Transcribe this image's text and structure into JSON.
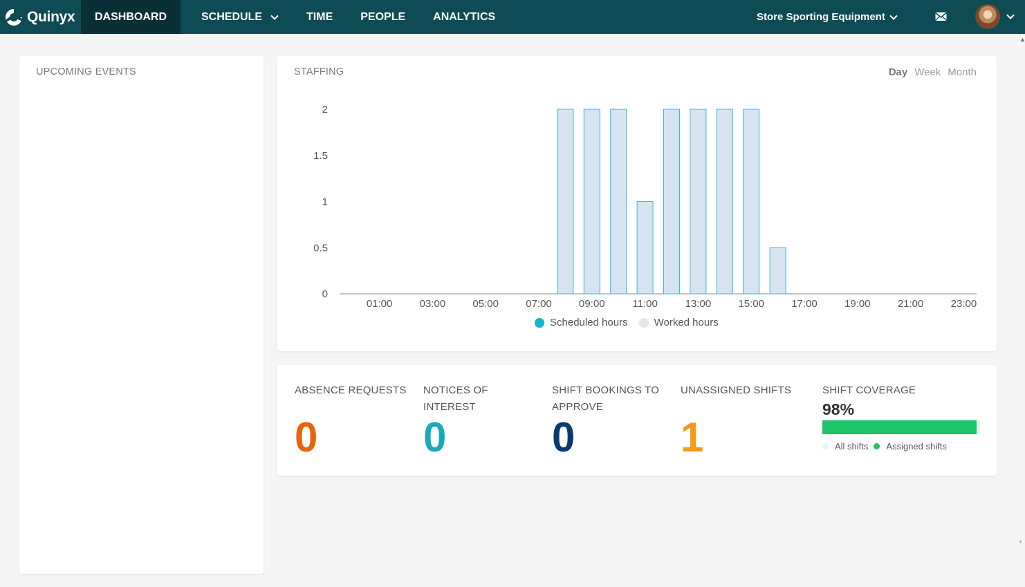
{
  "app": {
    "logo_text": "Quinyx"
  },
  "nav": {
    "items": [
      {
        "label": "DASHBOARD"
      },
      {
        "label": "SCHEDULE"
      },
      {
        "label": "TIME"
      },
      {
        "label": "PEOPLE"
      },
      {
        "label": "ANALYTICS"
      }
    ],
    "active": "DASHBOARD",
    "store": "Store Sporting Equipment"
  },
  "events": {
    "title": "UPCOMING EVENTS"
  },
  "staffing": {
    "title": "STAFFING",
    "periods": [
      "Day",
      "Week",
      "Month"
    ],
    "selected_period": "Day"
  },
  "chart_data": {
    "type": "bar",
    "x_hours": [
      0,
      1,
      2,
      3,
      4,
      5,
      6,
      7,
      8,
      9,
      10,
      11,
      12,
      13,
      14,
      15,
      16,
      17,
      18,
      19,
      20,
      21,
      22,
      23
    ],
    "tick_labels": [
      "01:00",
      "03:00",
      "05:00",
      "07:00",
      "09:00",
      "11:00",
      "13:00",
      "15:00",
      "17:00",
      "19:00",
      "21:00",
      "23:00"
    ],
    "y_ticks": [
      "0",
      "0.5",
      "1",
      "1.5",
      "2"
    ],
    "ylim": [
      0,
      2
    ],
    "series": [
      {
        "name": "Scheduled hours",
        "color": "#17b3cf",
        "values": [
          0,
          0,
          0,
          0,
          0,
          0,
          0,
          0,
          2,
          2,
          2,
          1,
          2,
          2,
          2,
          2,
          0.5,
          0,
          0,
          0,
          0,
          0,
          0,
          0
        ]
      },
      {
        "name": "Worked hours",
        "color": "#e6e6e6",
        "values": [
          0,
          0,
          0,
          0,
          0,
          0,
          0,
          0,
          0,
          0,
          0,
          0,
          0,
          0,
          0,
          0,
          0,
          0,
          0,
          0,
          0,
          0,
          0,
          0
        ]
      }
    ],
    "bar_fill": "#d6e3f0",
    "bar_stroke": "#3fb6d3",
    "legend": "bottom-center",
    "grid": false
  },
  "stats": {
    "absence": {
      "label": "ABSENCE REQUESTS",
      "value": "0",
      "color": "#e8650a"
    },
    "notices": {
      "label": "NOTICES OF INTEREST",
      "value": "0",
      "color": "#1aa9b7"
    },
    "bookings": {
      "label": "SHIFT BOOKINGS TO APPROVE",
      "value": "0",
      "color": "#0a3a72"
    },
    "unassigned": {
      "label": "UNASSIGNED SHIFTS",
      "value": "1",
      "color": "#f59a1b"
    },
    "coverage": {
      "label": "SHIFT COVERAGE",
      "percent_text": "98%",
      "fraction": 0.98,
      "legend": [
        "All shifts",
        "Assigned shifts"
      ],
      "colors": {
        "all": "#e3f7ec",
        "assigned": "#1dc36a"
      }
    }
  }
}
